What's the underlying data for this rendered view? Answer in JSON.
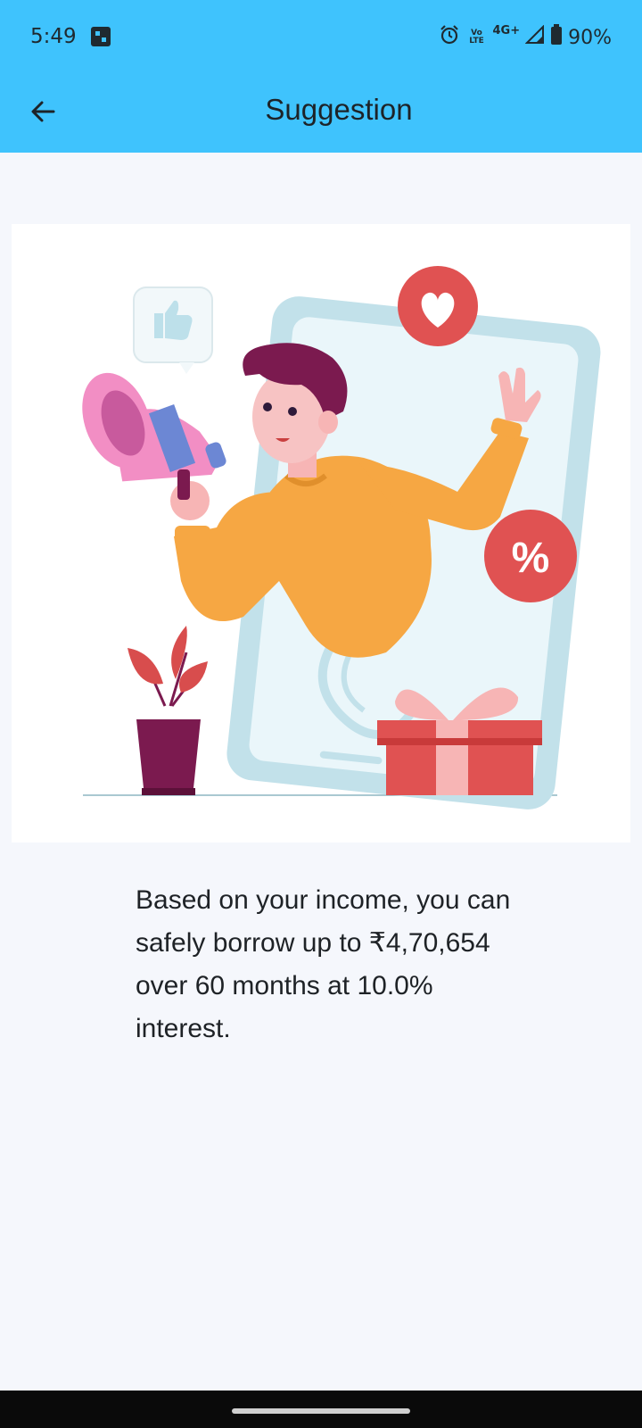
{
  "status_bar": {
    "time": "5:49",
    "volte_label": "Vo LTE",
    "network_type": "4G+",
    "battery": "90%",
    "icons": [
      "notification-icon",
      "alarm-icon",
      "signal-icon",
      "battery-icon"
    ]
  },
  "app_bar": {
    "title": "Suggestion",
    "back_icon": "arrow-left-icon"
  },
  "illustration": {
    "description_icons": [
      "megaphone",
      "thumbs-up",
      "heart",
      "percent",
      "gift",
      "plant",
      "phone"
    ]
  },
  "message": {
    "text": "Based on your income, you can safely borrow up to ₹4,70,654 over 60 months at 10.0% interest."
  },
  "colors": {
    "accent": "#3fc3fd",
    "background": "#f5f7fc",
    "heart_badge": "#e05252",
    "sweater": "#f6a743"
  }
}
